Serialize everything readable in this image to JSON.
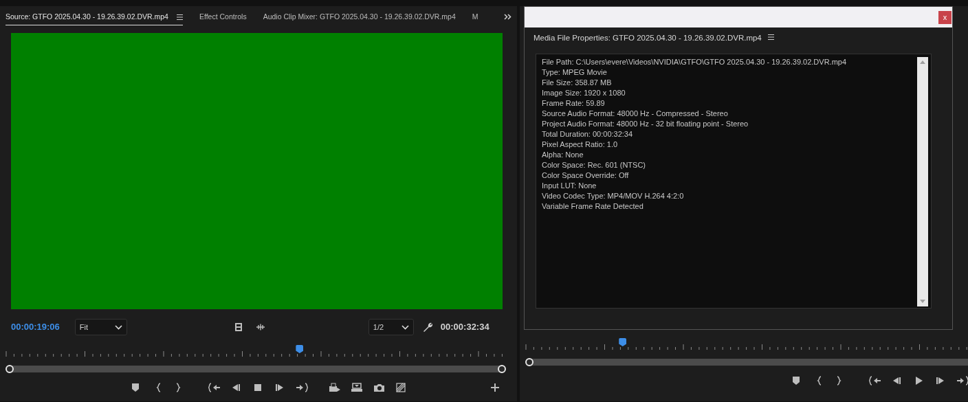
{
  "source_monitor": {
    "tabs": [
      {
        "label": "Source: GTFO 2025.04.30 - 19.26.39.02.DVR.mp4",
        "selected": true,
        "menu": true
      },
      {
        "label": "Effect Controls",
        "selected": false,
        "menu": false
      },
      {
        "label": "Audio Clip Mixer: GTFO 2025.04.30 - 19.26.39.02.DVR.mp4",
        "selected": false,
        "menu": false
      },
      {
        "label": "M",
        "selected": false,
        "menu": false
      }
    ],
    "timecode": "00:00:19:06",
    "zoom_select": "Fit",
    "resolution_select": "1/2",
    "duration": "00:00:32:34",
    "playhead": {
      "level": 0.587
    },
    "playing": true
  },
  "program_monitor": {
    "playhead": {
      "level": 0.214
    },
    "playing": false
  },
  "dialog": {
    "close_label": "x",
    "title": "Media File Properties: GTFO 2025.04.30 - 19.26.39.02.DVR.mp4",
    "lines": [
      "File Path: C:\\Users\\evere\\Videos\\NVIDIA\\GTFO\\GTFO 2025.04.30 - 19.26.39.02.DVR.mp4",
      "Type: MPEG Movie",
      "File Size: 358.87 MB",
      "Image Size: 1920 x 1080",
      "Frame Rate: 59.89",
      "Source Audio Format: 48000 Hz - Compressed - Stereo",
      "Project Audio Format: 48000 Hz - 32 bit floating point - Stereo",
      "Total Duration: 00:00:32:34",
      "Pixel Aspect Ratio: 1.0",
      "Alpha: None",
      "Color Space: Rec. 601 (NTSC)",
      "Color Space Override: Off",
      "Input LUT: None",
      "Video Codec Type: MP4/MOV H.264 4:2:0",
      "Variable Frame Rate Detected"
    ]
  }
}
